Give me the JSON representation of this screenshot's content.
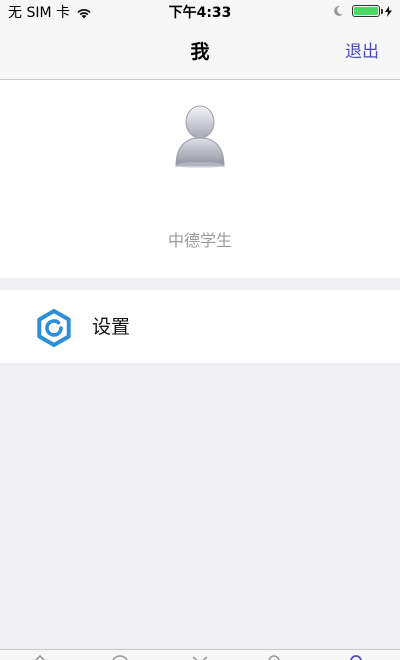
{
  "status_bar": {
    "carrier": "无 SIM 卡",
    "time": "下午4:33",
    "battery_level": 1.0,
    "battery_color": "#4cd964",
    "icons": [
      "wifi-icon",
      "moon-icon",
      "battery-icon",
      "charging-bolt-icon"
    ]
  },
  "nav": {
    "title": "我",
    "logout_label": "退出",
    "accent_color": "#4b4bb8"
  },
  "profile": {
    "name": "中德学生",
    "avatar_icon": "person-avatar-icon"
  },
  "settings": {
    "label": "设置",
    "icon": "gear-icon",
    "icon_color": "#2f8fd6"
  },
  "tab_bar": {
    "items": [
      {
        "icon": "home-icon"
      },
      {
        "icon": "message-icon"
      },
      {
        "icon": "discover-icon"
      },
      {
        "icon": "contacts-icon"
      },
      {
        "icon": "profile-icon",
        "active": true
      }
    ]
  }
}
